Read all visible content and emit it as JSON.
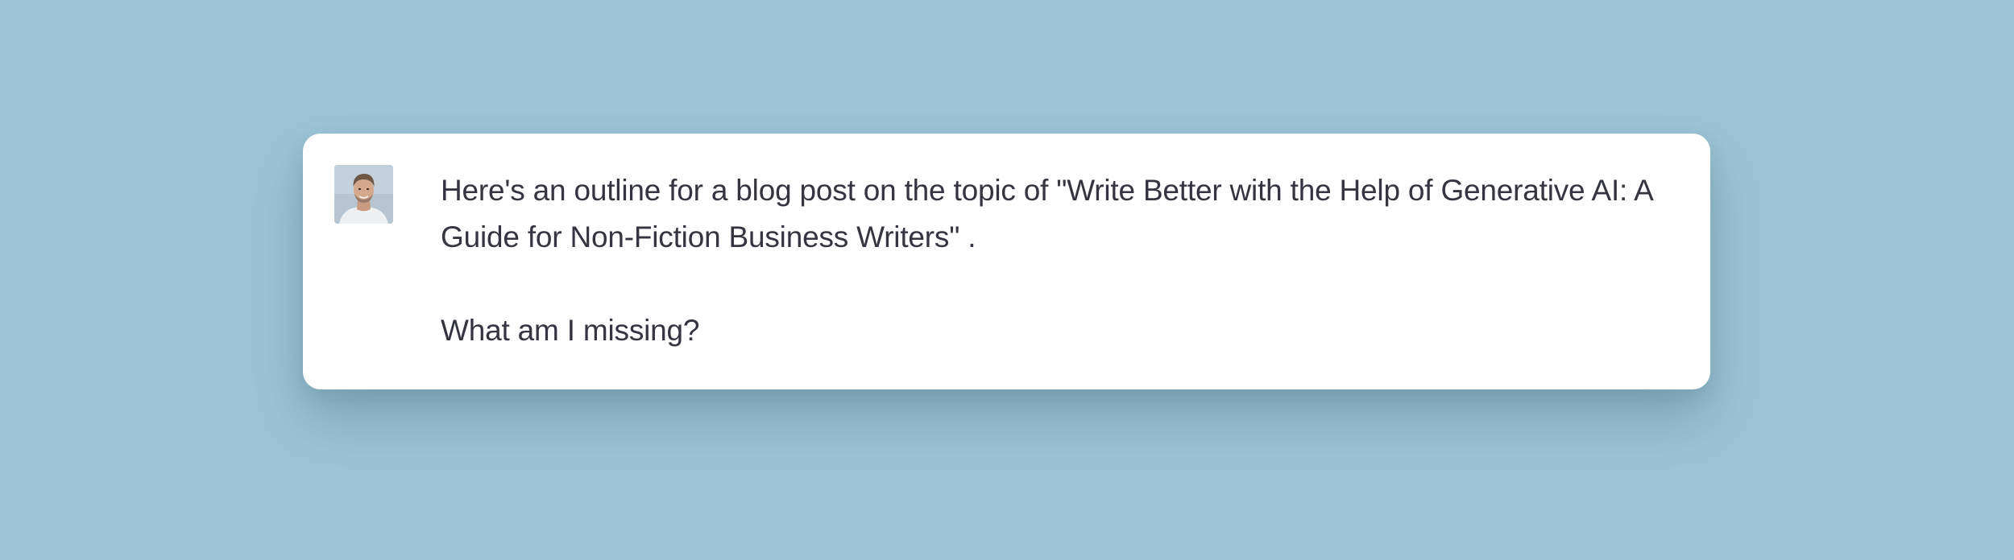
{
  "chat": {
    "avatar_icon": "user-avatar-photo",
    "message": {
      "paragraph_1": "Here's an outline for a blog post on the topic of \"Write Better with the Help of Generative AI: A Guide for Non-Fiction Business Writers\" .",
      "paragraph_2": "What am I missing?"
    }
  },
  "colors": {
    "background": "#9dc5d5",
    "card": "#ffffff",
    "text": "#343541"
  }
}
